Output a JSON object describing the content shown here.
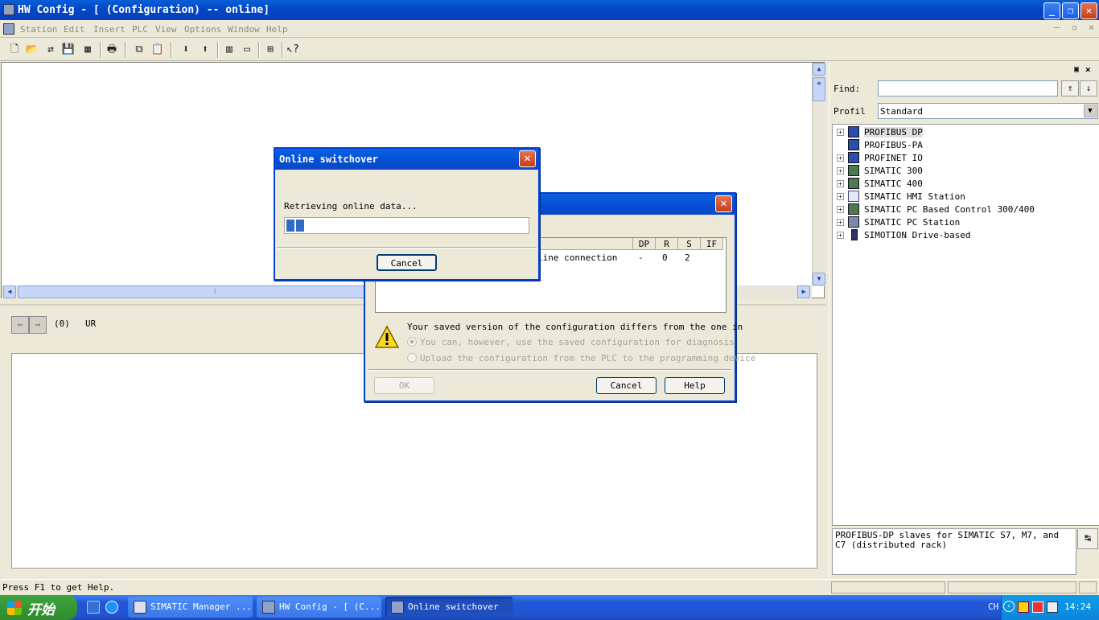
{
  "window": {
    "title": "HW Config - [ (Configuration) -- online]"
  },
  "menu": [
    "Station",
    "Edit",
    "Insert",
    "PLC",
    "View",
    "Options",
    "Window",
    "Help"
  ],
  "rack": {
    "slot_label": "(0)",
    "rack_name": "UR"
  },
  "catalog": {
    "find_label": "Find:",
    "find_value": "",
    "profile_label": "Profil",
    "profile_value": "Standard",
    "items": [
      {
        "label": "PROFIBUS DP",
        "expandable": true,
        "icon": "profibus-icon"
      },
      {
        "label": "PROFIBUS-PA",
        "expandable": false,
        "icon": "profibus-icon"
      },
      {
        "label": "PROFINET IO",
        "expandable": true,
        "icon": "profinet-icon"
      },
      {
        "label": "SIMATIC 300",
        "expandable": true,
        "icon": "simatic-rack-icon"
      },
      {
        "label": "SIMATIC 400",
        "expandable": true,
        "icon": "simatic-rack-icon"
      },
      {
        "label": "SIMATIC HMI Station",
        "expandable": true,
        "icon": "hmi-icon"
      },
      {
        "label": "SIMATIC PC Based Control 300/400",
        "expandable": true,
        "icon": "simatic-rack-icon"
      },
      {
        "label": "SIMATIC PC Station",
        "expandable": true,
        "icon": "pc-station-icon"
      },
      {
        "label": "SIMOTION Drive-based",
        "expandable": true,
        "icon": "drive-icon"
      }
    ],
    "description": "PROFIBUS-DP slaves for SIMATIC S7, M7, and C7 (distributed rack)"
  },
  "status": {
    "help_text": "Press F1 to get Help."
  },
  "dialog_back": {
    "columns": [
      "DP",
      "R",
      "S",
      "IF"
    ],
    "row": {
      "name": "line connection",
      "dp": "-",
      "r": "0",
      "s": "2",
      "if": ""
    },
    "message": "Your saved version of the configuration differs from the one in",
    "option1": "You can, however, use the saved configuration for diagnosis",
    "option2": "Upload the configuration from the PLC to the programming device",
    "ok_label": "OK",
    "cancel_label": "Cancel",
    "help_label": "Help"
  },
  "dialog_front": {
    "title": "Online switchover",
    "message": "Retrieving online data...",
    "progress": 0.08,
    "cancel_label": "Cancel"
  },
  "taskbar": {
    "start_label": "开始",
    "tasks": [
      "SIMATIC Manager ...",
      "HW Config - [ (C...",
      "Online switchover"
    ],
    "lang": "CH",
    "clock": "14:24"
  },
  "colors": {
    "title_blue": "#0548d0",
    "progress_blue": "#316ac5"
  }
}
